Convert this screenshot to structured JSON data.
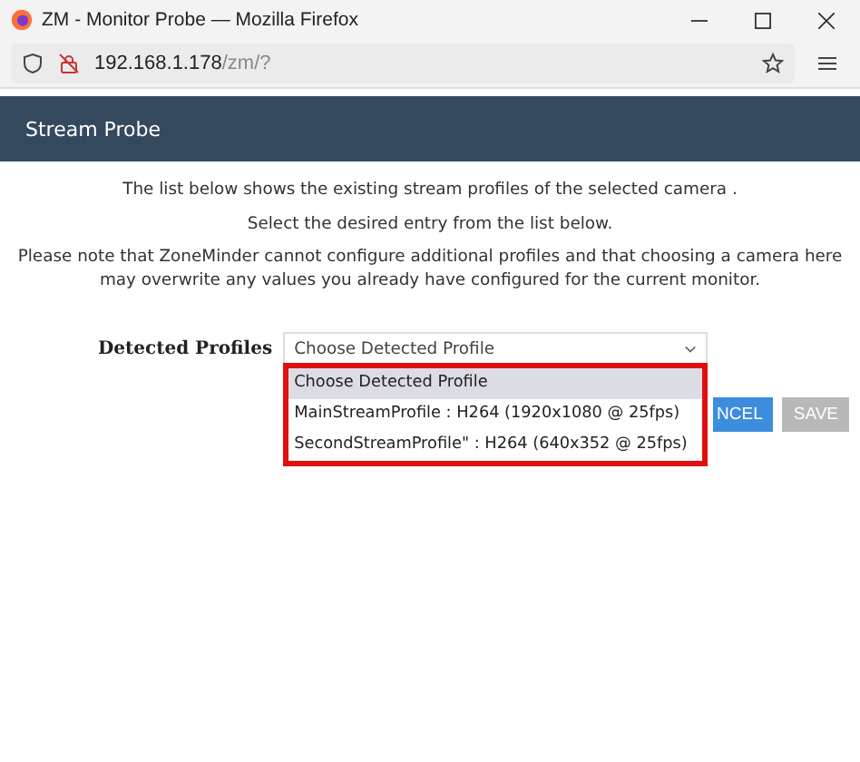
{
  "window": {
    "title": "ZM - Monitor Probe — Mozilla Firefox"
  },
  "address_bar": {
    "host": "192.168.1.178",
    "path": "/zm/?"
  },
  "page_header": {
    "title": "Stream Probe"
  },
  "intro": [
    "The list below shows the existing stream profiles of the selected camera .",
    "Select the desired entry from the list below.",
    "Please note that ZoneMinder cannot configure additional profiles and that choosing a camera here may overwrite any values you already have configured for the current monitor."
  ],
  "detected_profiles": {
    "label": "Detected Profiles",
    "value": "Choose Detected Profile",
    "expanded": true,
    "options": [
      {
        "label": "Choose Detected Profile",
        "selected": true
      },
      {
        "label": "MainStreamProfile : H264 (1920x1080 @ 25fps)",
        "selected": false
      },
      {
        "label": "SecondStreamProfile\" : H264 (640x352 @ 25fps)",
        "selected": false
      }
    ]
  },
  "buttons": [
    {
      "label": "NCEL",
      "kind": "primary"
    },
    {
      "label": "SAVE",
      "kind": "disabled"
    }
  ]
}
